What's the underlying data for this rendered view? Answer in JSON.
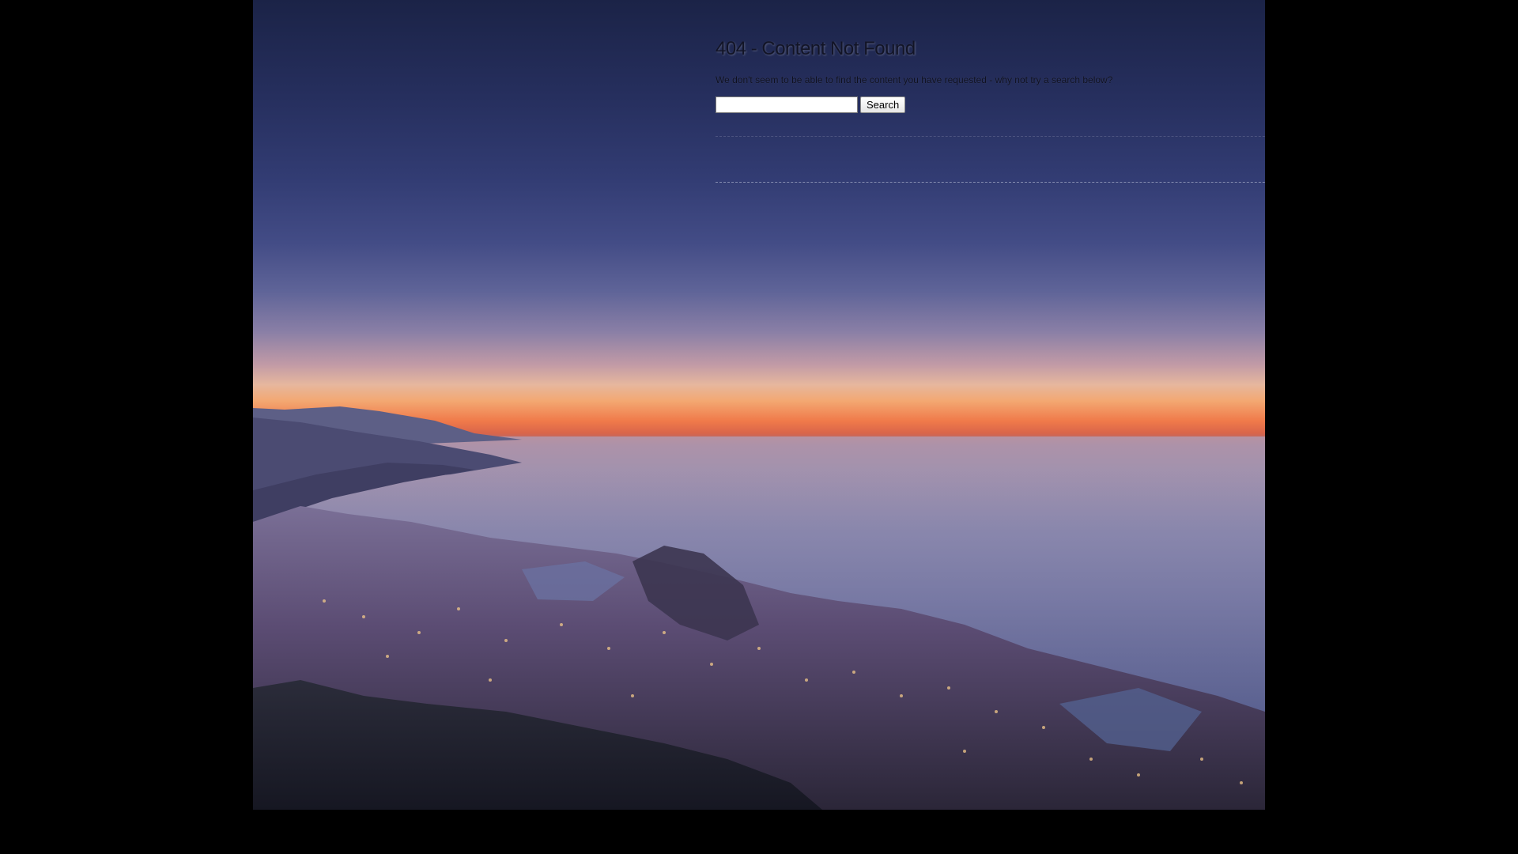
{
  "page": {
    "title": "404 - Content Not Found",
    "message": "We don't seem to be able to find the content you have requested - why not try a search below?"
  },
  "search": {
    "value": "",
    "placeholder": "",
    "button_label": "Search"
  },
  "background": {
    "description": "sunset-coastal-city",
    "sky_top_color": "#1b2347",
    "horizon_color": "#f07a4a",
    "page_color": "#000000"
  }
}
